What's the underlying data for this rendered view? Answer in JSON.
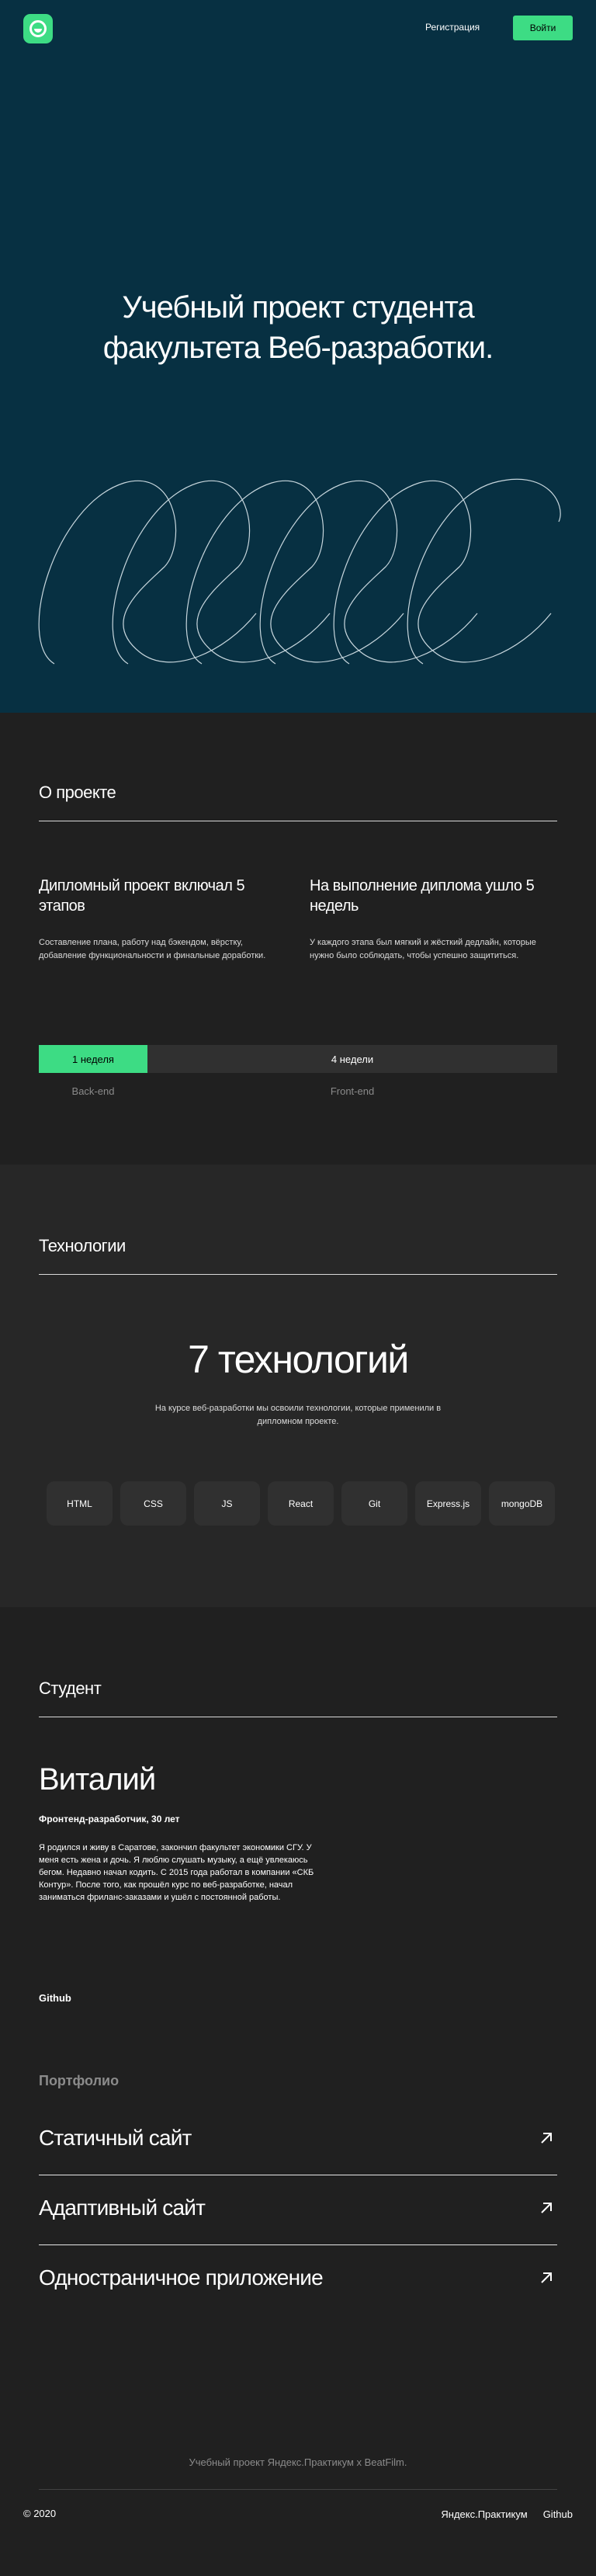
{
  "header": {
    "register_label": "Регистрация",
    "login_label": "Войти"
  },
  "hero": {
    "title": "Учебный проект студента факультета Веб-разработки."
  },
  "about": {
    "title": "О проекте",
    "columns": [
      {
        "heading": "Дипломный проект включал 5 этапов",
        "text": "Составление плана, работу над бэкендом, вёрстку, добавление функциональности и финальные доработки."
      },
      {
        "heading": "На выполнение диплома ушло 5 недель",
        "text": "У каждого этапа был мягкий и жёсткий дедлайн, которые нужно было соблюдать, чтобы успешно защититься."
      }
    ],
    "timeline": {
      "backend_duration": "1 неделя",
      "frontend_duration": "4 недели",
      "backend_label": "Back-end",
      "frontend_label": "Front-end"
    }
  },
  "tech": {
    "title": "Технологии",
    "headline": "7 технологий",
    "description": "На курсе веб-разработки мы освоили технологии, которые применили в дипломном проекте.",
    "items": [
      "HTML",
      "CSS",
      "JS",
      "React",
      "Git",
      "Express.js",
      "mongoDB"
    ]
  },
  "student": {
    "title": "Студент",
    "name": "Виталий",
    "job": "Фронтенд-разработчик, 30 лет",
    "bio": "Я родился и живу в Саратове, закончил факультет экономики СГУ. У меня есть жена и дочь. Я люблю слушать музыку, а ещё увлекаюсь бегом. Недавно начал кодить. С 2015 года работал в компании «СКБ Контур». После того, как прошёл курс по веб-разработке, начал заниматься фриланс-заказами и ушёл с постоянной работы.",
    "github_label": "Github"
  },
  "portfolio": {
    "title": "Портфолио",
    "items": [
      {
        "label": "Статичный сайт",
        "icon": "arrow-up-right-icon"
      },
      {
        "label": "Адаптивный сайт",
        "icon": "arrow-up-right-icon"
      },
      {
        "label": "Одностраничное приложение",
        "icon": "arrow-up-right-icon"
      }
    ]
  },
  "footer": {
    "caption": "Учебный проект Яндекс.Практикум х BeatFilm.",
    "copyright": "© 2020",
    "links": [
      "Яндекс.Практикум",
      "Github"
    ]
  },
  "colors": {
    "accent": "#3ddc84",
    "hero_bg": "#073042",
    "page_bg": "#202020",
    "muted_text": "#8b8b8b"
  }
}
